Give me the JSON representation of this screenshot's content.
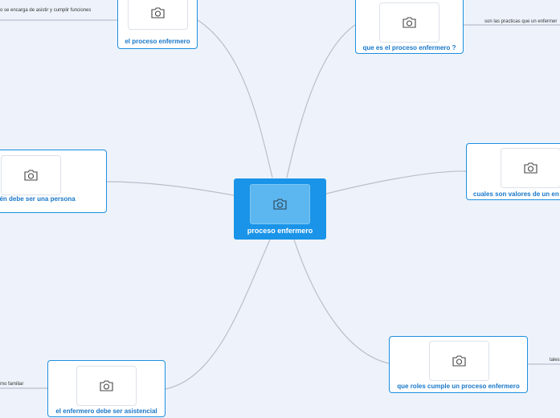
{
  "root": {
    "label": "proceso enfermero"
  },
  "nodes": [
    {
      "id": "el-proceso-enfermero",
      "label": "el proceso enfermero"
    },
    {
      "id": "que-es",
      "label": "que es el proceso enfermero ?"
    },
    {
      "id": "tambien-persona",
      "label": "o también debe ser una persona"
    },
    {
      "id": "cuales-valores",
      "label": "cuales son valores de un en"
    },
    {
      "id": "que-roles",
      "label": "que roles cumple un proceso enfermero"
    },
    {
      "id": "asistencial",
      "label": "el enfermero debe ser asistencial"
    }
  ],
  "notes": [
    {
      "id": "note-asistir",
      "text": "o se encarga de asistir y cumplir funciones"
    },
    {
      "id": "note-practicas",
      "text": "son las practicas que un enfermer"
    },
    {
      "id": "note-tales",
      "text": "tales"
    },
    {
      "id": "note-familiar",
      "text": "mo familiar"
    }
  ],
  "colors": {
    "root_fill": "#1a94e8",
    "node_border": "#1d8fe0",
    "node_text": "#1877c9",
    "link": "#b8bfcc",
    "background": "#eef3fb"
  },
  "icons": {
    "placeholder": "camera-icon"
  }
}
